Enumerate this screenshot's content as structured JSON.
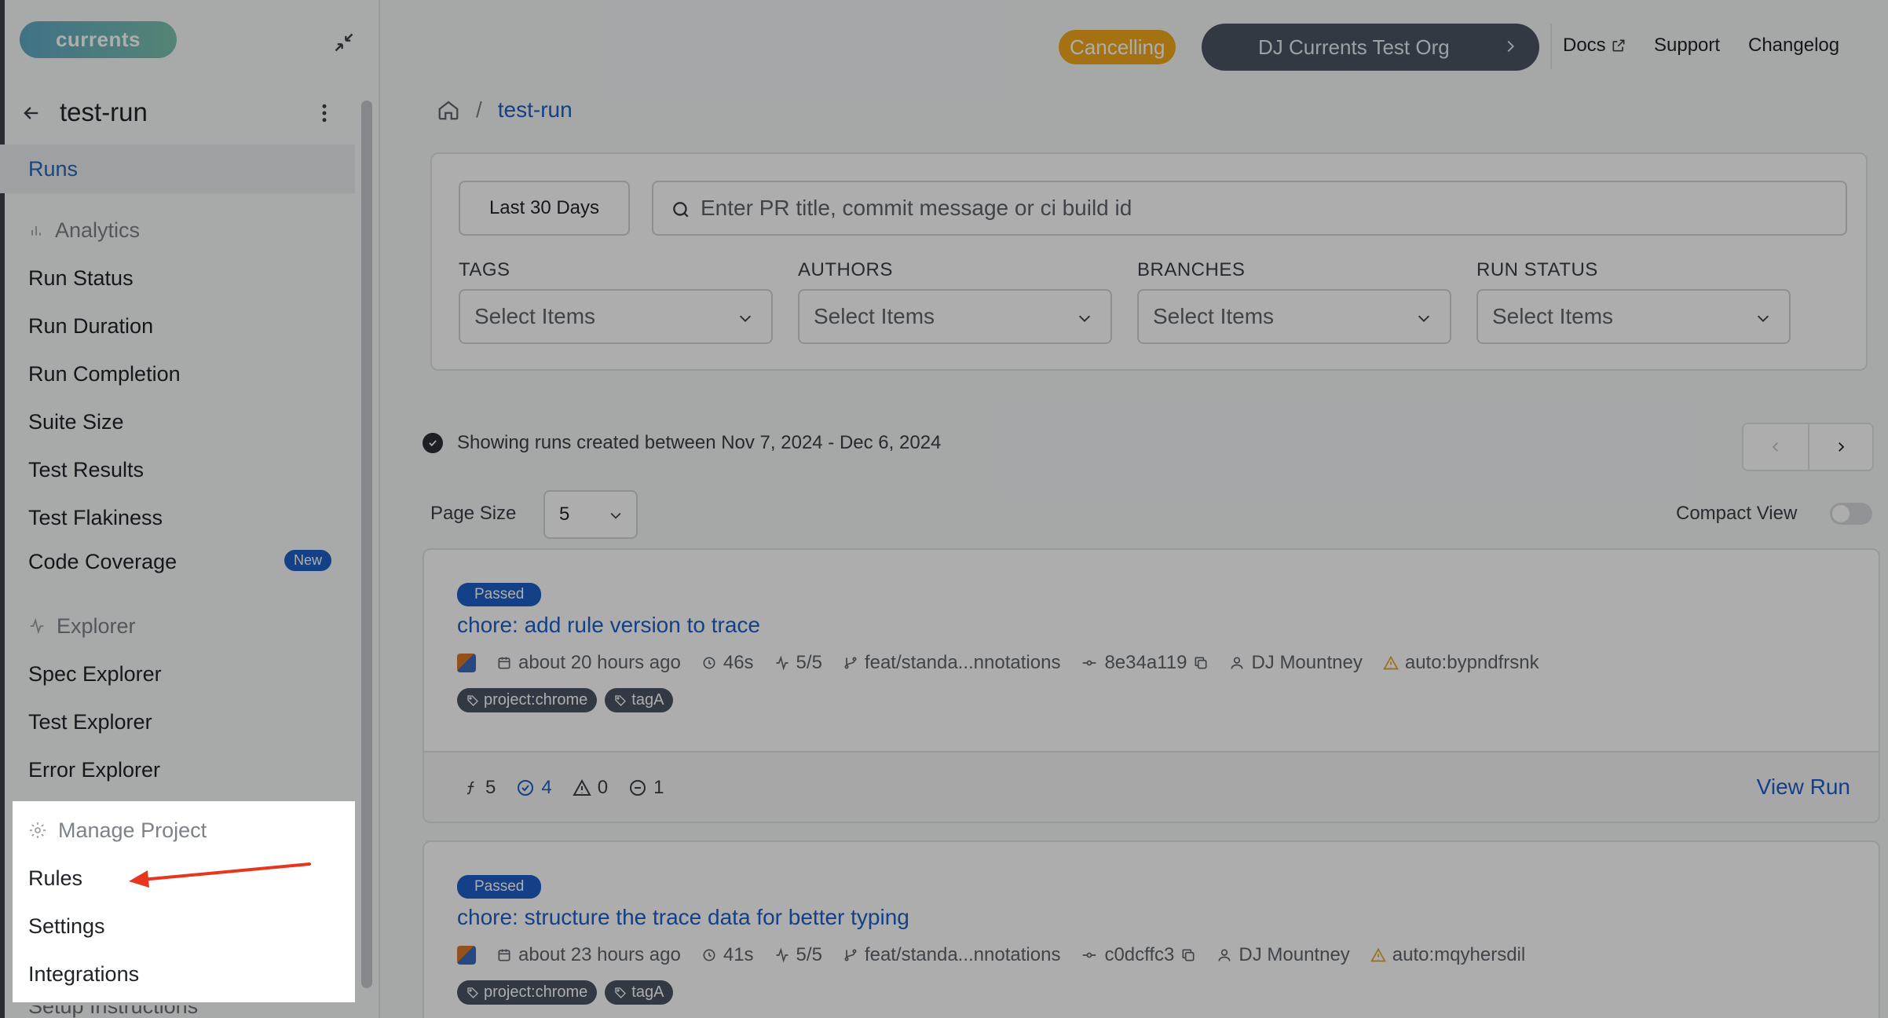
{
  "app": {
    "logo_text": "currents"
  },
  "header": {
    "status_pill": "Cancelling",
    "org_name": "DJ Currents Test Org",
    "links": {
      "docs": "Docs",
      "support": "Support",
      "changelog": "Changelog"
    }
  },
  "sidebar": {
    "project_name": "test-run",
    "runs": "Runs",
    "analytics": {
      "title": "Analytics",
      "items": [
        "Run Status",
        "Run Duration",
        "Run Completion",
        "Suite Size",
        "Test Results",
        "Test Flakiness",
        "Code Coverage"
      ],
      "new_badge": "New"
    },
    "explorer": {
      "title": "Explorer",
      "items": [
        "Spec Explorer",
        "Test Explorer",
        "Error Explorer"
      ]
    },
    "manage": {
      "title": "Manage Project",
      "items": [
        "Rules",
        "Settings",
        "Integrations"
      ],
      "cut_off_item": "Setup Instructions"
    }
  },
  "breadcrumb": {
    "current": "test-run",
    "separator": "/"
  },
  "filters": {
    "date_range": "Last 30 Days",
    "search_placeholder": "Enter PR title, commit message or ci build id",
    "groups": [
      {
        "label": "TAGS",
        "value": "Select Items"
      },
      {
        "label": "AUTHORS",
        "value": "Select Items"
      },
      {
        "label": "BRANCHES",
        "value": "Select Items"
      },
      {
        "label": "RUN STATUS",
        "value": "Select Items"
      }
    ]
  },
  "listing": {
    "showing_text": "Showing runs created between Nov 7, 2024 - Dec 6, 2024",
    "page_size_label": "Page Size",
    "page_size_value": "5",
    "compact_view_label": "Compact View",
    "compact_view_on": false
  },
  "runs": [
    {
      "status": "Passed",
      "title": "chore: add rule version to trace",
      "time": "about 20 hours ago",
      "duration": "46s",
      "specs": "5/5",
      "branch": "feat/standa...nnotations",
      "commit": "8e34a119",
      "author": "DJ Mountney",
      "ci_build": "auto:bypndfrsnk",
      "tags": [
        "project:chrome",
        "tagA"
      ],
      "stats": {
        "tests": "5",
        "passed": "4",
        "flaky": "0",
        "skipped": "1"
      },
      "view_label": "View Run"
    },
    {
      "status": "Passed",
      "title": "chore: structure the trace data for better typing",
      "time": "about 23 hours ago",
      "duration": "41s",
      "specs": "5/5",
      "branch": "feat/standa...nnotations",
      "commit": "c0dcffc3",
      "author": "DJ Mountney",
      "ci_build": "auto:mqyhersdil",
      "tags": [
        "project:chrome",
        "tagA"
      ]
    }
  ],
  "colors": {
    "accent": "#1c5fc6",
    "warning": "#f2a91c",
    "org_button": "#4a5563",
    "annotation_arrow": "#e8351e"
  }
}
